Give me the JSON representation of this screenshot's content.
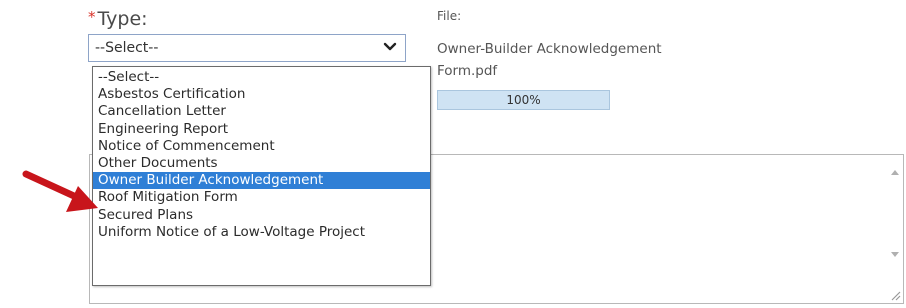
{
  "type_field": {
    "required_mark": "*",
    "label": "Type:",
    "selected_value": "--Select--"
  },
  "file_info": {
    "label": "File:",
    "name_line1": "Owner-Builder Acknowledgement",
    "name_line2": "Form.pdf",
    "progress_value": 1.0,
    "progress_text": "100%"
  },
  "dropdown": {
    "options": [
      "--Select--",
      "Asbestos Certification",
      "Cancellation Letter",
      "Engineering Report",
      "Notice of Commencement",
      "Other Documents",
      "Owner Builder Acknowledgement",
      "Roof Mitigation Form",
      "Secured Plans",
      "Uniform Notice of a Low-Voltage Project"
    ],
    "highlighted_index": 6
  },
  "colors": {
    "highlight": "#2f7fd6",
    "arrow": "#c8151b",
    "required": "#d9342b",
    "progress": "#cfe3f3"
  },
  "icons": {
    "select": "chevron-down-icon",
    "pointer": "red-arrow-icon",
    "scroll_up": "scroll-up-icon",
    "scroll_down": "scroll-down-icon",
    "resize": "resize-grip-icon"
  }
}
